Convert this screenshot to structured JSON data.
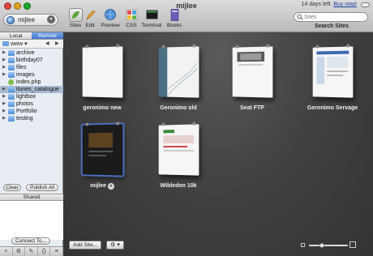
{
  "window": {
    "title": "mijlee",
    "trial_text": "14 days left.",
    "buy_link": "Buy now!"
  },
  "site_selector": {
    "value": "mijlee"
  },
  "toolbar": {
    "buttons": [
      {
        "label": "Sites",
        "icon": "sites-icon"
      },
      {
        "label": "Edit",
        "icon": "pencil-icon"
      },
      {
        "label": "Preview",
        "icon": "preview-globe-icon"
      },
      {
        "label": "CSS",
        "icon": "css-icon"
      },
      {
        "label": "Terminal",
        "icon": "terminal-icon"
      },
      {
        "label": "Books",
        "icon": "books-icon"
      }
    ],
    "active": "Sites"
  },
  "search": {
    "placeholder": "Sites",
    "label": "Search Sites"
  },
  "sidebar": {
    "tabs": [
      "Local",
      "Remote"
    ],
    "active_tab": "Remote",
    "path": "www",
    "items": [
      {
        "name": "archive",
        "type": "folder"
      },
      {
        "name": "birthday07",
        "type": "folder"
      },
      {
        "name": "files",
        "type": "folder"
      },
      {
        "name": "images",
        "type": "folder"
      },
      {
        "name": "index.php",
        "type": "file"
      },
      {
        "name": "itunes_catalogue",
        "type": "folder",
        "selected": true
      },
      {
        "name": "lightbox",
        "type": "folder"
      },
      {
        "name": "photos",
        "type": "folder"
      },
      {
        "name": "Portfolio",
        "type": "folder"
      },
      {
        "name": "testing",
        "type": "folder"
      }
    ],
    "clear_label": "Clear",
    "publish_label": "Publish All",
    "shared_label": "Shared",
    "connect_label": "Connect To...",
    "bottom_tools": [
      "+",
      "⚙",
      "✎",
      "{}",
      "≡"
    ]
  },
  "sites": [
    {
      "label": "geronimo new"
    },
    {
      "label": "Geronimo old"
    },
    {
      "label": "Seat FTP"
    },
    {
      "label": "Geronimo Servage"
    },
    {
      "label": "mijlee",
      "selected": true,
      "badge": "✕"
    },
    {
      "label": "Wibledon 10k"
    }
  ],
  "footer": {
    "add_site_label": "Add Site...",
    "gear_label": "⚙ ▾",
    "zoom_level": 0.3
  }
}
